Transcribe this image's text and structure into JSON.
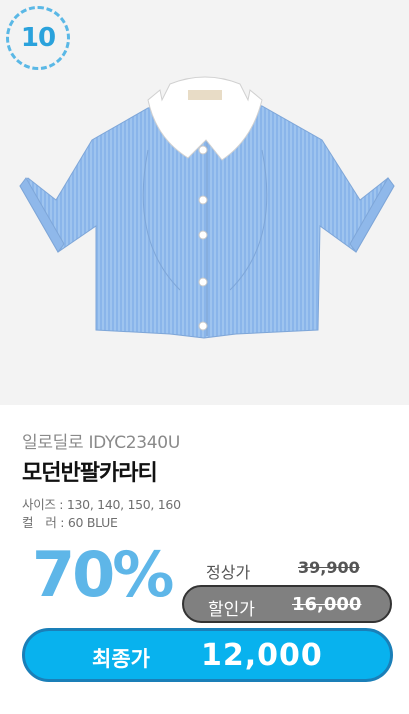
{
  "rank": "10",
  "product": {
    "brand": "일로딜로 IDYC2340U",
    "name": "모던반팔카라티",
    "sizes": "사이즈 : 130, 140, 150, 160",
    "color": "컬　러 : 60 BLUE"
  },
  "price": {
    "discount_rate": "70%",
    "regular_label": "정상가",
    "regular_value": "39,900",
    "sale_label": "할인가",
    "sale_value": "16,000",
    "final_label": "최종가",
    "final_value": "12,000"
  },
  "colors": {
    "accent": "#08b2ee",
    "discount": "#5eb6e8",
    "badge": "#2aa2dc",
    "sale_pill": "#808080"
  },
  "icons": {
    "product_image": "cropped-striped-collar-shirt-image"
  }
}
